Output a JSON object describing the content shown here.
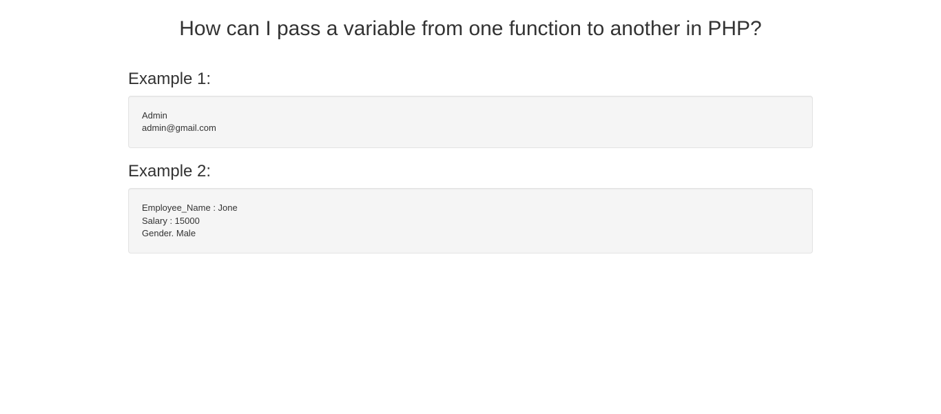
{
  "title": "How can I pass a variable from one function to another in PHP?",
  "sections": [
    {
      "heading": "Example 1:",
      "output": "Admin\nadmin@gmail.com"
    },
    {
      "heading": "Example 2:",
      "output": "Employee_Name : Jone\nSalary : 15000\nGender. Male"
    }
  ]
}
